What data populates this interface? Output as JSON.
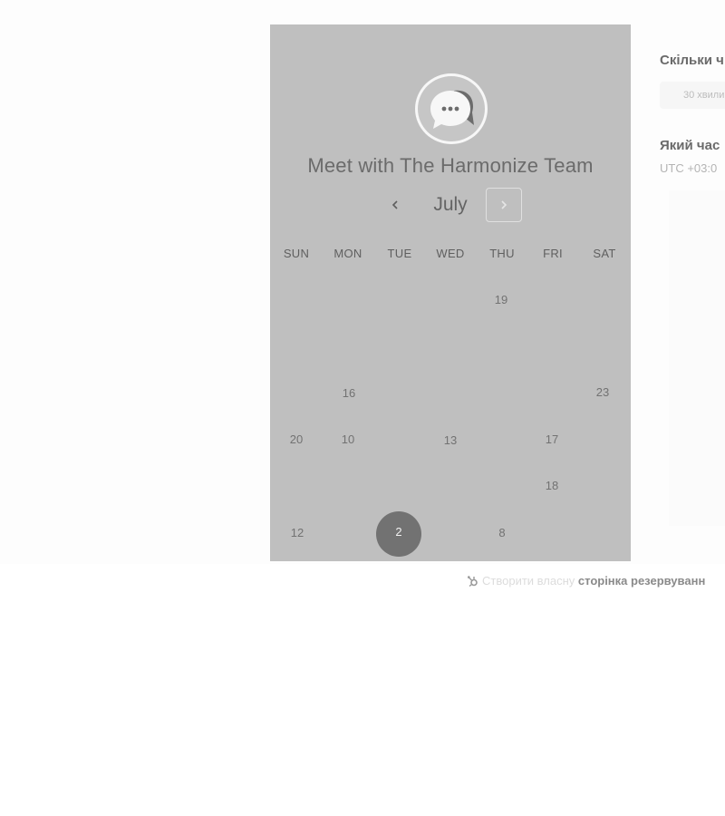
{
  "card": {
    "title": "Meet with The Harmonize Team",
    "month": "July",
    "weekdays": [
      "SUN",
      "MON",
      "TUE",
      "WED",
      "THU",
      "FRI",
      "SAT"
    ],
    "days": [
      "19",
      "16",
      "23",
      "20",
      "10",
      "13",
      "17",
      "18",
      "12",
      "2",
      "8"
    ],
    "selected_day": "2",
    "avatar_icon": "chat-bubble-icon",
    "prev_icon": "chevron-left-icon",
    "next_icon": "chevron-right-icon"
  },
  "panel": {
    "duration_question": "Скільки ч",
    "duration_value": "30 хвили",
    "time_question": "Який час",
    "timezone": "UTC +03:0"
  },
  "footer": {
    "prefix": "Створити власну",
    "link": "сторінка резервуванн",
    "icon": "hubspot-sprocket-icon"
  },
  "colors": {
    "card_bg": "#bfbfbf",
    "selected_day_bg": "#727272"
  }
}
